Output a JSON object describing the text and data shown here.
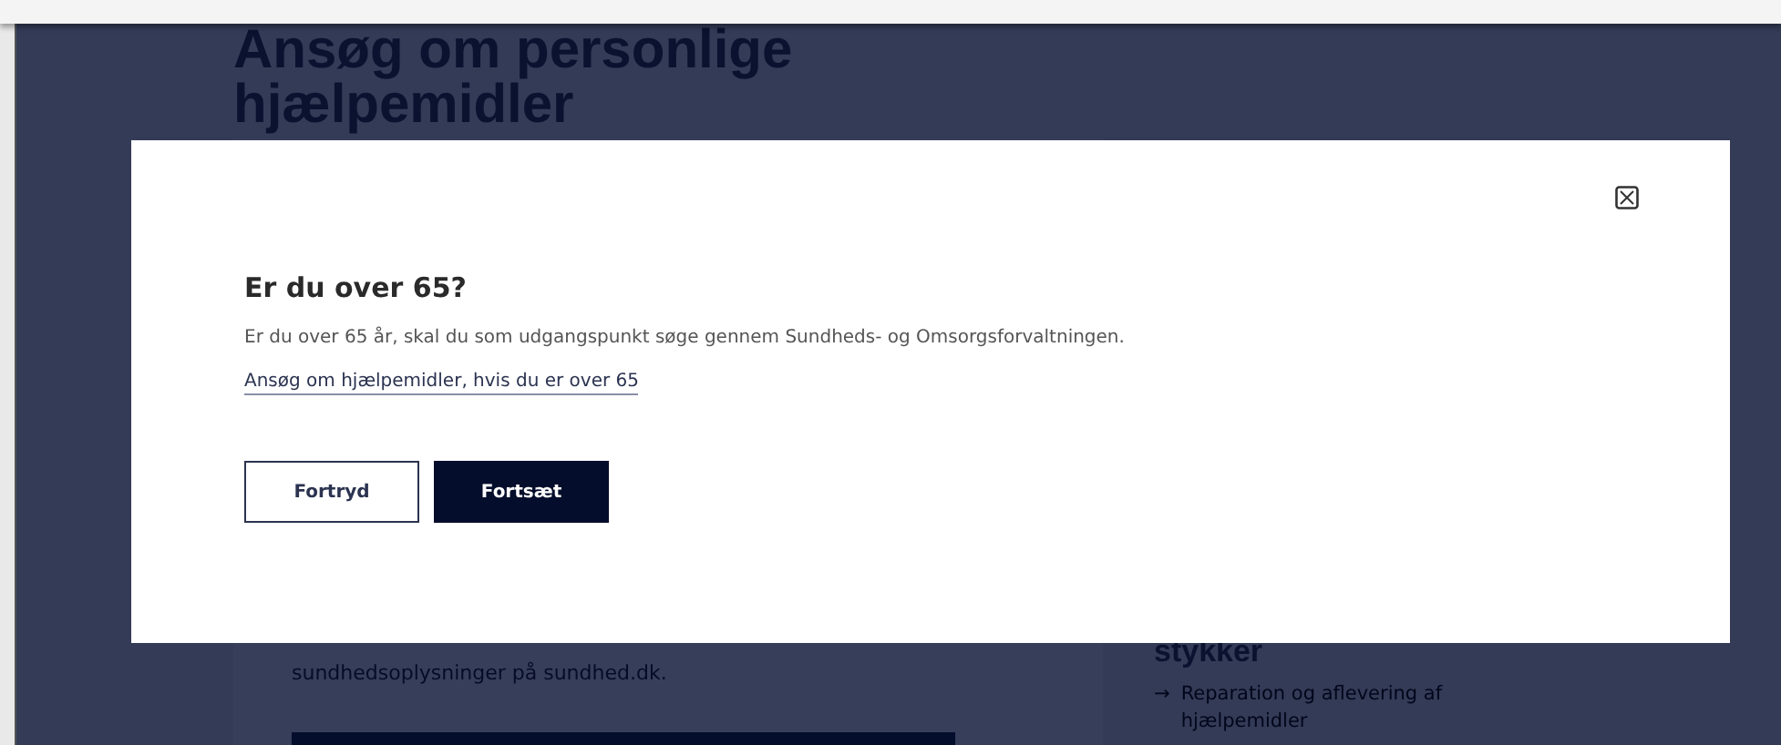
{
  "page": {
    "title_lines": [
      "Ansøg om personlige",
      "hjælpemidler"
    ],
    "body_text": "sundhedsoplysninger på sundhed.dk.",
    "side_heading": "stykker",
    "side_links": [
      {
        "icon": "→",
        "label": "Reparation og aflevering af hjælpemidler"
      }
    ]
  },
  "dialog": {
    "heading": "Er du over 65?",
    "text": "Er du over 65 år, skal du som udgangspunkt søge gennem Sundheds- og Omsorgsforvaltningen.",
    "link": "Ansøg om hjælpemidler, hvis du er over 65",
    "buttons": [
      {
        "label": "Fortryd",
        "kind": "secondary"
      },
      {
        "label": "Fortsæt",
        "kind": "primary"
      }
    ]
  }
}
